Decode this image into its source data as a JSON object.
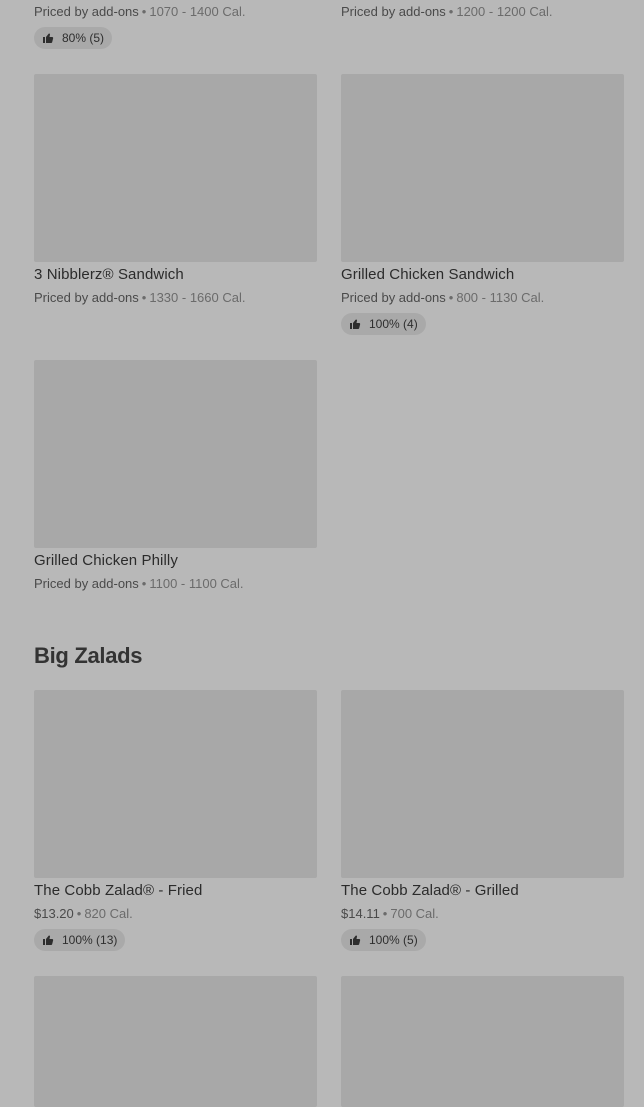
{
  "top_row": {
    "left": {
      "price": "Priced by add-ons",
      "calories": "1070 - 1400 Cal.",
      "rating": "80% (5)"
    },
    "right": {
      "price": "Priced by add-ons",
      "calories": "1200 - 1200 Cal."
    }
  },
  "items": [
    {
      "name": "3 Nibblerz® Sandwich",
      "price": "Priced by add-ons",
      "calories": "1330 - 1660 Cal."
    },
    {
      "name": "Grilled Chicken Sandwich",
      "price": "Priced by add-ons",
      "calories": "800 - 1130 Cal.",
      "rating": "100% (4)"
    },
    {
      "name": "Grilled Chicken Philly",
      "price": "Priced by add-ons",
      "calories": "1100 - 1100 Cal."
    }
  ],
  "section": {
    "title": "Big Zalads"
  },
  "zalads": [
    {
      "name": "The Cobb Zalad® - Fried",
      "price": "$13.20",
      "calories": "820 Cal.",
      "rating": "100% (13)"
    },
    {
      "name": "The Cobb Zalad® - Grilled",
      "price": "$14.11",
      "calories": "700 Cal.",
      "rating": "100% (5)"
    }
  ],
  "separator": "•",
  "icons": {
    "rating": "thumbs-up-icon"
  }
}
